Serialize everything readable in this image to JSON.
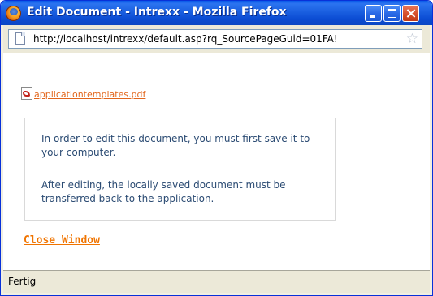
{
  "window": {
    "title": "Edit Document - Intrexx - Mozilla Firefox"
  },
  "address_bar": {
    "url": "http://localhost/intrexx/default.asp?rq_SourcePageGuid=01FA!"
  },
  "content": {
    "attachment_link": "applicationtemplates.pdf",
    "info_paragraph_1": "In order to edit this document, you must first save it to your computer.",
    "info_paragraph_2": "After editing, the locally saved document must be transferred back to the application.",
    "close_link": "Close Window"
  },
  "status_bar": {
    "text": "Fertig"
  },
  "icons": {
    "app": "firefox-icon",
    "page": "page-icon",
    "bookmark": "star-icon",
    "attachment": "pdf-icon"
  },
  "colors": {
    "titlebar": "#0b4cd3",
    "link": "#e2661c",
    "close_link": "#f07400",
    "info_text": "#2b4b73"
  }
}
